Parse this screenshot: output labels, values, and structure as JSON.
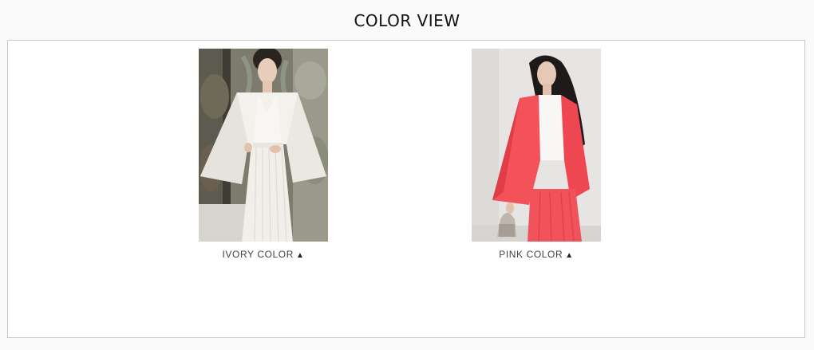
{
  "header": {
    "title": "COLOR VIEW"
  },
  "items": [
    {
      "label": "IVORY COLOR",
      "icon": "triangle-up-icon",
      "arrow": "▲",
      "garment_color": "#f3f1ec"
    },
    {
      "label": "PINK COLOR",
      "icon": "triangle-up-icon",
      "arrow": "▲",
      "garment_color": "#f4525a"
    }
  ],
  "colors": {
    "page_background": "#fafafa",
    "frame_border": "#c9c9c9",
    "caption_text": "#444444"
  }
}
